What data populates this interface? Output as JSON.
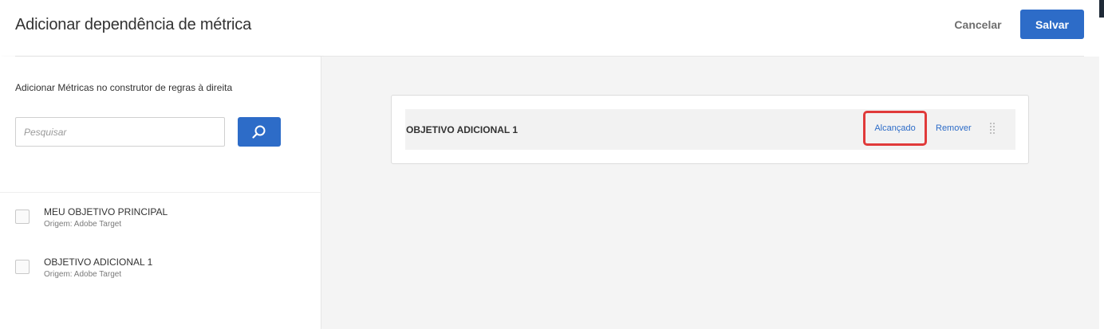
{
  "dialog": {
    "title": "Adicionar dependência de métrica",
    "cancel_label": "Cancelar",
    "save_label": "Salvar"
  },
  "left_panel": {
    "instruction": "Adicionar Métricas no construtor de regras à direita",
    "search": {
      "placeholder": "Pesquisar",
      "value": "",
      "button_icon": "search-icon"
    },
    "metrics": [
      {
        "name": "MEU OBJETIVO PRINCIPAL",
        "origin": "Origem: Adobe Target",
        "checked": false
      },
      {
        "name": "OBJETIVO ADICIONAL 1",
        "origin": "Origem: Adobe Target",
        "checked": false
      }
    ]
  },
  "rule_builder": {
    "items": [
      {
        "title": "OBJETIVO ADICIONAL 1",
        "condition_label": "Alcançado",
        "remove_label": "Remover",
        "drag_icon": "drag-handle-icon"
      }
    ]
  },
  "colors": {
    "accent": "#2d6cc8",
    "highlight": "#e03a3a"
  }
}
